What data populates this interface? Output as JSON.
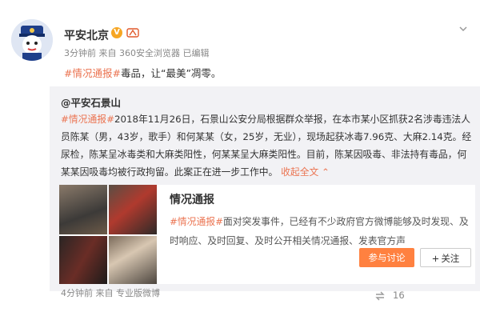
{
  "post": {
    "author": "平安北京",
    "meta": "3分钟前 来自 360安全浏览器  已编辑",
    "tag": "#情况通报#",
    "text_before": "毒品，让",
    "quoted": "“最美”",
    "text_after": "凋零。"
  },
  "repost": {
    "author": "@平安石景山",
    "tag": "#情况通报#",
    "body": "2018年11月26日，石景山公安分局根据群众举报，在本市某小区抓获2名涉毒违法人员陈某（男，43岁，歌手）和何某某（女，25岁，无业），现场起获冰毒7.96克、大麻2.14克。经尿检，陈某呈冰毒类和大麻类阳性，何某某呈大麻类阳性。目前，陈某因吸毒、非法持有毒品，何某某因吸毒均被行政拘留。此案正在进一步工作中。",
    "collapse": "收起全文",
    "collapse_arrow": "⌃",
    "footer": "4分钟前 来自 专业版微博"
  },
  "card": {
    "title": "情况通报",
    "tag": "#情况通报#",
    "desc": "面对突发事件，已经有不少政府官方微博能够及时发现、及时响应、及时回复、及时公开相关情况通报、发表官方声",
    "discuss_button": "参与讨论",
    "follow_plus": "+",
    "follow_button": "关注"
  },
  "actions": {
    "share_count": "16"
  },
  "colors": {
    "accent": "#eb7350",
    "button_orange": "#ff8140",
    "repost_bg": "#f2f2f5"
  }
}
